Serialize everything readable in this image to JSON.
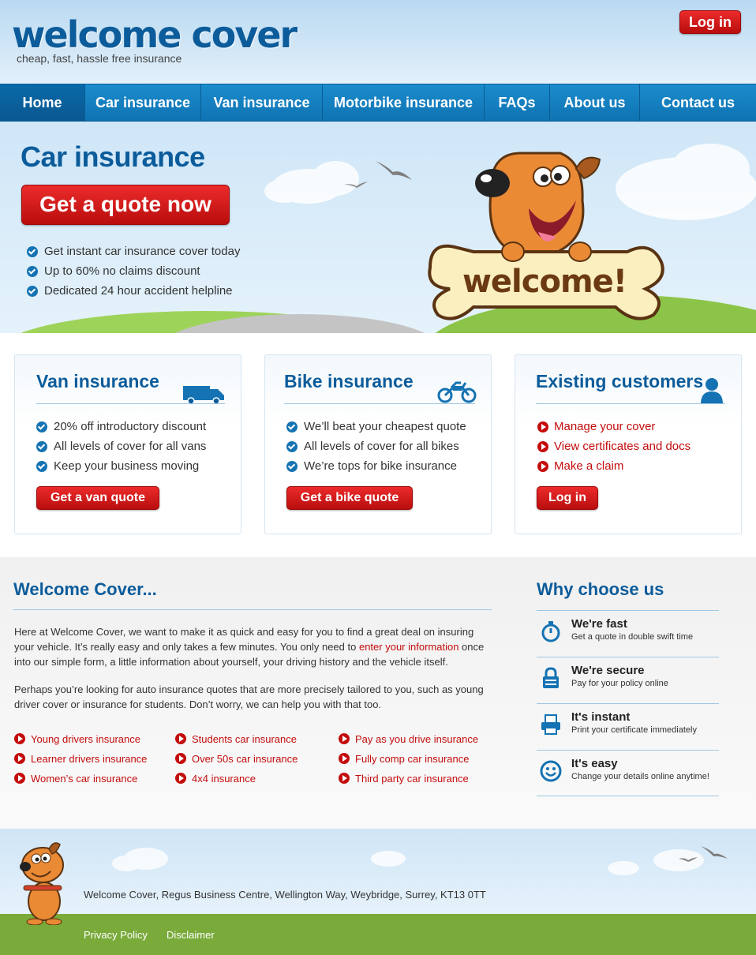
{
  "header": {
    "logo": "welcome cover",
    "tagline": "cheap, fast, hassle free insurance",
    "login_label": "Log in"
  },
  "nav": [
    {
      "label": "Home",
      "active": true
    },
    {
      "label": "Car insurance"
    },
    {
      "label": "Van insurance"
    },
    {
      "label": "Motorbike insurance"
    },
    {
      "label": "FAQs"
    },
    {
      "label": "About us"
    },
    {
      "label": "Contact us"
    }
  ],
  "hero": {
    "title": "Car insurance",
    "cta": "Get a quote now",
    "bullets": [
      "Get instant car insurance cover today",
      "Up to 60% no claims discount",
      "Dedicated 24 hour accident helpline"
    ],
    "sign_text": "welcome!"
  },
  "panels": {
    "van": {
      "title": "Van insurance",
      "bullets": [
        "20% off introductory discount",
        "All levels of cover for all vans",
        "Keep your business moving"
      ],
      "button": "Get a van quote"
    },
    "bike": {
      "title": "Bike insurance",
      "bullets": [
        "We’ll beat your cheapest quote",
        "All levels of cover for all bikes",
        "We’re tops for bike insurance"
      ],
      "button": "Get a bike quote"
    },
    "existing": {
      "title": "Existing customers",
      "links": [
        "Manage your cover",
        "View certificates and docs",
        "Make a claim"
      ],
      "button": "Log in"
    }
  },
  "welcome": {
    "title": "Welcome Cover...",
    "para1_before": "Here at Welcome Cover, we want to make it as quick and easy for you to find a great deal on insuring your vehicle. It’s really easy and only takes a few minutes. You only need to ",
    "para1_link": "enter your information",
    "para1_after": " once into our simple form, a little information about yourself, your driving history and the vehicle itself.",
    "para2": "Perhaps you’re looking for auto insurance quotes that are more precisely tailored to you, such as young driver cover or insurance for students. Don’t worry, we can help you with that too.",
    "links_col1": [
      "Young drivers insurance",
      "Learner drivers insurance",
      "Women’s car insurance"
    ],
    "links_col2": [
      "Students car insurance",
      "Over 50s car insurance",
      "4x4 insurance"
    ],
    "links_col3": [
      "Pay as you drive insurance",
      "Fully comp car insurance",
      "Third party car insurance"
    ]
  },
  "why": {
    "title": "Why choose us",
    "items": [
      {
        "icon": "stopwatch-icon",
        "head": "We're fast",
        "sub": "Get a quote in double swift time"
      },
      {
        "icon": "padlock-icon",
        "head": "We're secure",
        "sub": "Pay for your policy online"
      },
      {
        "icon": "printer-icon",
        "head": "It's instant",
        "sub": "Print your certificate immediately"
      },
      {
        "icon": "smiley-icon",
        "head": "It's easy",
        "sub": "Change your details online anytime!"
      }
    ]
  },
  "footer": {
    "address": "Welcome Cover, Regus Business Centre, Wellington Way, Weybridge, Surrey, KT13 0TT",
    "links": [
      "Privacy Policy",
      "Disclaimer"
    ]
  },
  "colors": {
    "brand_blue": "#0c5c9b",
    "nav_blue": "#1480c2",
    "cta_red": "#d01818",
    "grass": "#79aa3a"
  }
}
